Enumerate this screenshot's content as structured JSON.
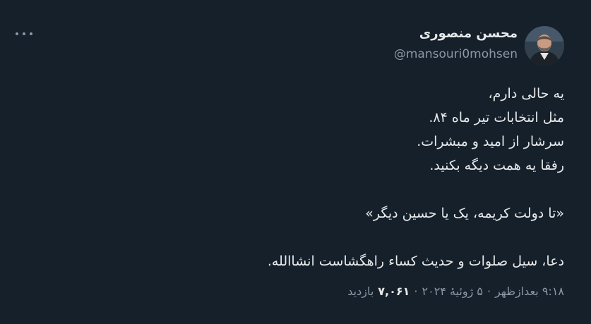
{
  "tweet": {
    "author": {
      "display_name": "محسن منصوری",
      "handle": "@mansouri0mohsen",
      "avatar_icon": "profile-photo"
    },
    "more_icon": "more-horizontal-icon",
    "lines": [
      "یه حالی دارم،",
      "مثل انتخابات تیر ماه ۸۴.",
      "سرشار از امید و مبشرات.",
      "رفقا یه همت دیگه بکنید.",
      "",
      "«تا دولت کریمه، یک یا حسین دیگر»",
      "",
      "دعا، سیل صلوات و حدیث کساء راهگشاست انشاالله."
    ],
    "time": "۹:۱۸ بعدازظهر",
    "date": "۵ ژوئیهٔ ۲۰۲۴",
    "views_count": "۷,۰۶۱",
    "views_label": "بازدید",
    "separator": "·"
  },
  "colors": {
    "background": "#15202b",
    "text": "#e7e9ea",
    "secondary": "#8b98a5"
  }
}
